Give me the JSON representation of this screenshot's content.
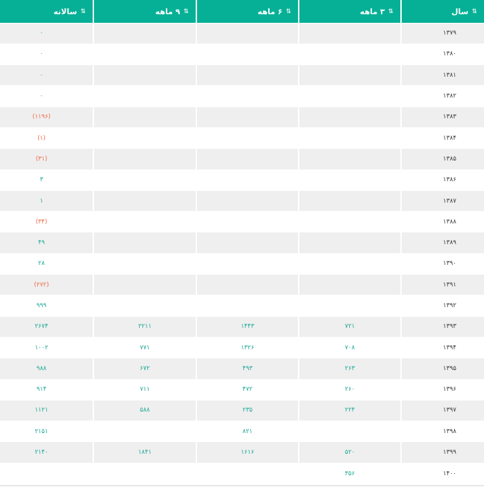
{
  "table": {
    "headers": {
      "year": "سال",
      "m3": "۳ ماهه",
      "m6": "۶ ماهه",
      "m9": "۹ ماهه",
      "yearly": "سالانه"
    },
    "sort_icon": "sort-arrows-icon",
    "rows": [
      {
        "year": "۱۳۷۹",
        "m3": "",
        "m6": "",
        "m9": "",
        "yearly": "۰",
        "neg": false
      },
      {
        "year": "۱۳۸۰",
        "m3": "",
        "m6": "",
        "m9": "",
        "yearly": "۰",
        "neg": false
      },
      {
        "year": "۱۳۸۱",
        "m3": "",
        "m6": "",
        "m9": "",
        "yearly": "۰",
        "neg": false
      },
      {
        "year": "۱۳۸۲",
        "m3": "",
        "m6": "",
        "m9": "",
        "yearly": "۰",
        "neg": false
      },
      {
        "year": "۱۳۸۳",
        "m3": "",
        "m6": "",
        "m9": "",
        "yearly": "(۱۱۹۶)",
        "neg": true
      },
      {
        "year": "۱۳۸۴",
        "m3": "",
        "m6": "",
        "m9": "",
        "yearly": "(۱)",
        "neg": true
      },
      {
        "year": "۱۳۸۵",
        "m3": "",
        "m6": "",
        "m9": "",
        "yearly": "(۳۱)",
        "neg": true
      },
      {
        "year": "۱۳۸۶",
        "m3": "",
        "m6": "",
        "m9": "",
        "yearly": "۳",
        "neg": false
      },
      {
        "year": "۱۳۸۷",
        "m3": "",
        "m6": "",
        "m9": "",
        "yearly": "۱",
        "neg": false
      },
      {
        "year": "۱۳۸۸",
        "m3": "",
        "m6": "",
        "m9": "",
        "yearly": "(۳۴)",
        "neg": true
      },
      {
        "year": "۱۳۸۹",
        "m3": "",
        "m6": "",
        "m9": "",
        "yearly": "۴۹",
        "neg": false
      },
      {
        "year": "۱۳۹۰",
        "m3": "",
        "m6": "",
        "m9": "",
        "yearly": "۲۸",
        "neg": false
      },
      {
        "year": "۱۳۹۱",
        "m3": "",
        "m6": "",
        "m9": "",
        "yearly": "(۲۷۲)",
        "neg": true
      },
      {
        "year": "۱۳۹۲",
        "m3": "",
        "m6": "",
        "m9": "",
        "yearly": "۹۹۹",
        "neg": false
      },
      {
        "year": "۱۳۹۳",
        "m3": "۷۲۱",
        "m6": "۱۴۴۳",
        "m9": "۲۲۱۱",
        "yearly": "۲۶۷۴",
        "neg": false
      },
      {
        "year": "۱۳۹۴",
        "m3": "۷۰۸",
        "m6": "۱۳۲۶",
        "m9": "۷۷۱",
        "yearly": "۱۰۰۲",
        "neg": false
      },
      {
        "year": "۱۳۹۵",
        "m3": "۲۶۳",
        "m6": "۴۹۳",
        "m9": "۶۷۲",
        "yearly": "۹۸۸",
        "neg": false
      },
      {
        "year": "۱۳۹۶",
        "m3": "۲۶۰",
        "m6": "۴۷۲",
        "m9": "۷۱۱",
        "yearly": "۹۱۴",
        "neg": false
      },
      {
        "year": "۱۳۹۷",
        "m3": "۲۲۴",
        "m6": "۲۳۵",
        "m9": "۵۸۸",
        "yearly": "۱۱۲۱",
        "neg": false
      },
      {
        "year": "۱۳۹۸",
        "m3": "",
        "m6": "۸۲۱",
        "m9": "",
        "yearly": "۲۱۵۱",
        "neg": false
      },
      {
        "year": "۱۳۹۹",
        "m3": "۵۲۰",
        "m6": "۱۶۱۶",
        "m9": "۱۸۴۱",
        "yearly": "۲۱۴۰",
        "neg": false
      },
      {
        "year": "۱۴۰۰",
        "m3": "۳۵۶",
        "m6": "",
        "m9": "",
        "yearly": "",
        "neg": false
      }
    ]
  }
}
